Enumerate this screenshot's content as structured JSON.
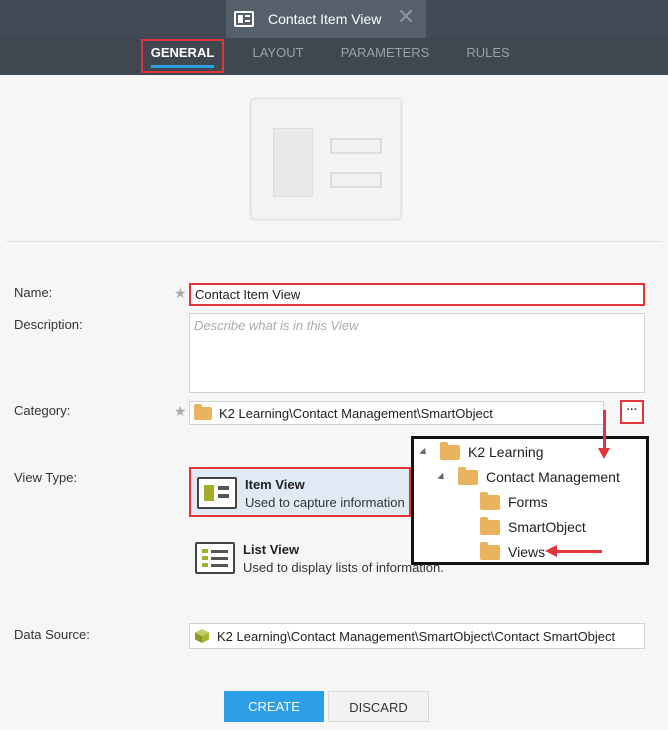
{
  "header": {
    "title": "Contact Item View",
    "close_glyph": "✕",
    "icon": "view-icon"
  },
  "tabs": [
    {
      "label": "GENERAL",
      "active": true
    },
    {
      "label": "LAYOUT",
      "active": false
    },
    {
      "label": "PARAMETERS",
      "active": false
    },
    {
      "label": "RULES",
      "active": false
    }
  ],
  "form": {
    "name_label": "Name:",
    "name_value": "Contact Item View",
    "description_label": "Description:",
    "description_placeholder": "Describe what is in this View",
    "category_label": "Category:",
    "category_value": "K2 Learning\\Contact Management\\SmartObject",
    "browse_label": "···",
    "view_type_label": "View Type:",
    "data_source_label": "Data Source:",
    "data_source_value": "K2 Learning\\Contact Management\\SmartObject\\Contact SmartObject",
    "required_mark": "★"
  },
  "view_types": {
    "item": {
      "title": "Item View",
      "description": "Used to capture information",
      "selected": true
    },
    "list": {
      "title": "List View",
      "description": "Used to display lists of information.",
      "selected": false
    }
  },
  "tree": {
    "root": "K2 Learning",
    "child": "Contact Management",
    "leaves": [
      "Forms",
      "SmartObject",
      "Views"
    ]
  },
  "buttons": {
    "create": "CREATE",
    "discard": "DISCARD"
  },
  "colors": {
    "accent": "#2d9fe6",
    "highlight": "#e0353b",
    "header_bg": "#424b55",
    "folder": "#eab35e"
  }
}
